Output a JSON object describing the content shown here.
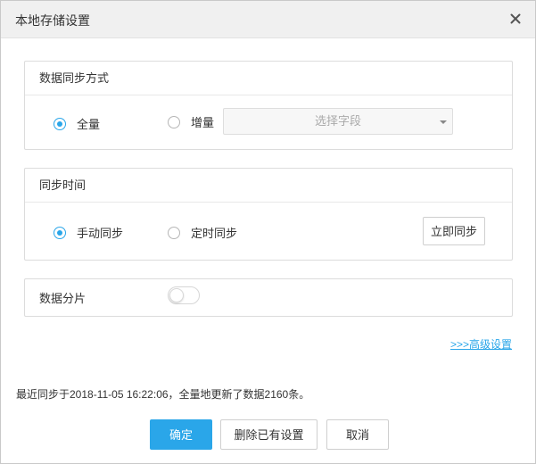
{
  "dialog": {
    "title": "本地存储设置",
    "close_icon": "close-icon"
  },
  "sync_mode": {
    "header": "数据同步方式",
    "options": [
      {
        "label": "全量",
        "checked": true
      },
      {
        "label": "增量",
        "checked": false
      }
    ],
    "field_select": {
      "placeholder": "选择字段"
    }
  },
  "sync_time": {
    "header": "同步时间",
    "options": [
      {
        "label": "手动同步",
        "checked": true
      },
      {
        "label": "定时同步",
        "checked": false
      }
    ],
    "sync_now_label": "立即同步"
  },
  "sharding": {
    "label": "数据分片",
    "enabled": false
  },
  "advanced_link": ">>>高级设置",
  "status_text": "最近同步于2018-11-05 16:22:06，全量地更新了数据2160条。",
  "footer": {
    "confirm_label": "确定",
    "delete_label": "删除已有设置",
    "cancel_label": "取消"
  },
  "colors": {
    "accent": "#2aa6e9",
    "titlebar_bg": "#f0f0f0"
  }
}
